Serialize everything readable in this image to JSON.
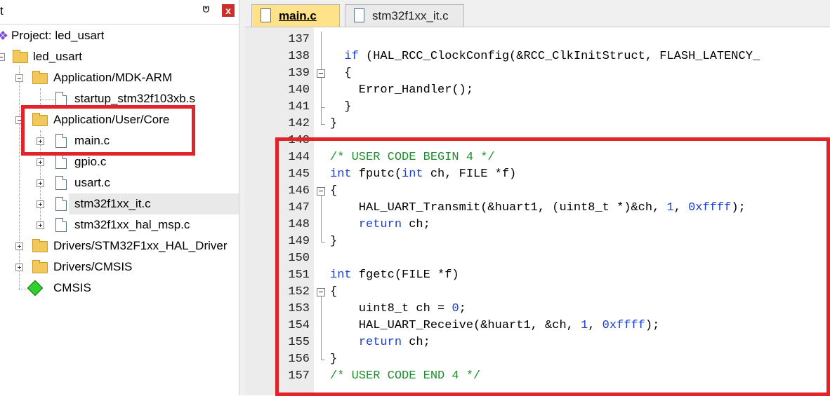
{
  "project_panel": {
    "title": "t",
    "pin_glyph": "⩅",
    "close_glyph": "x",
    "project_label": "Project: led_usart",
    "target": "led_usart",
    "groups": [
      {
        "label": "Application/MDK-ARM",
        "files": [
          "startup_stm32f103xb.s"
        ]
      },
      {
        "label": "Application/User/Core",
        "files": [
          "main.c",
          "gpio.c",
          "usart.c",
          "stm32f1xx_it.c",
          "stm32f1xx_hal_msp.c"
        ]
      },
      {
        "label": "Drivers/STM32F1xx_HAL_Driver"
      },
      {
        "label": "Drivers/CMSIS"
      }
    ],
    "cmsis_label": "CMSIS",
    "selected_file": "stm32f1xx_it.c"
  },
  "tabs": [
    {
      "label": "main.c",
      "active": true
    },
    {
      "label": "stm32f1xx_it.c",
      "active": false
    }
  ],
  "code_lines": [
    {
      "n": "137",
      "text": ""
    },
    {
      "n": "138",
      "text": "  if (HAL_RCC_ClockConfig(&RCC_ClkInitStruct, FLASH_LATENCY_"
    },
    {
      "n": "139",
      "text": "  {"
    },
    {
      "n": "140",
      "text": "    Error_Handler();"
    },
    {
      "n": "141",
      "text": "  }"
    },
    {
      "n": "142",
      "text": "}"
    },
    {
      "n": "143",
      "text": ""
    },
    {
      "n": "144",
      "text": "/* USER CODE BEGIN 4 */"
    },
    {
      "n": "145",
      "text": "int fputc(int ch, FILE *f)"
    },
    {
      "n": "146",
      "text": "{"
    },
    {
      "n": "147",
      "text": "    HAL_UART_Transmit(&huart1, (uint8_t *)&ch, 1, 0xffff);"
    },
    {
      "n": "148",
      "text": "    return ch;"
    },
    {
      "n": "149",
      "text": "}"
    },
    {
      "n": "150",
      "text": ""
    },
    {
      "n": "151",
      "text": "int fgetc(FILE *f)"
    },
    {
      "n": "152",
      "text": "{"
    },
    {
      "n": "153",
      "text": "    uint8_t ch = 0;"
    },
    {
      "n": "154",
      "text": "    HAL_UART_Receive(&huart1, &ch, 1, 0xffff);"
    },
    {
      "n": "155",
      "text": "    return ch;"
    },
    {
      "n": "156",
      "text": "}"
    },
    {
      "n": "157",
      "text": "/* USER CODE END 4 */"
    }
  ],
  "colors": {
    "highlight": "#e1242c",
    "keyword": "#1a3fd6",
    "comment": "#1f8f2f",
    "active_tab": "#ffe28a"
  }
}
